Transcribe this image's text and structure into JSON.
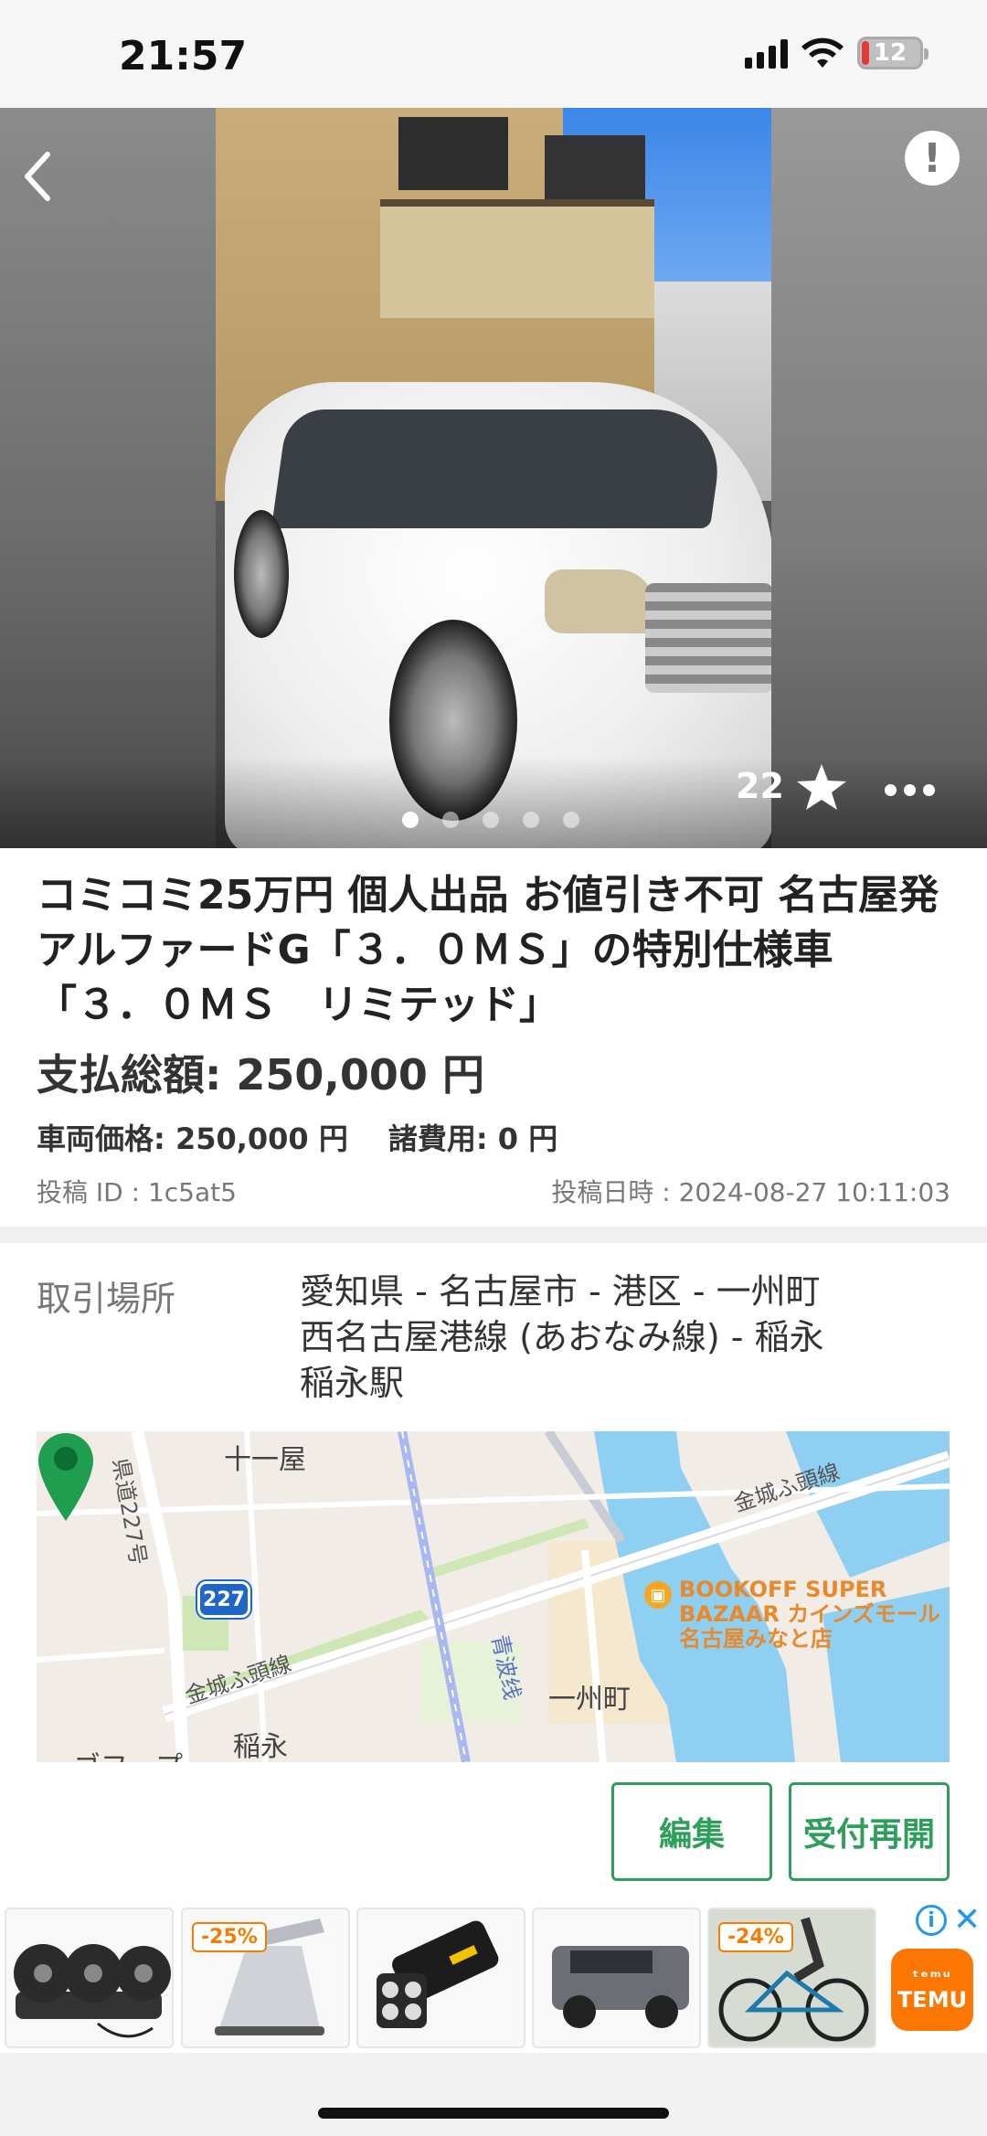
{
  "status_bar": {
    "time": "21:57",
    "battery": "12",
    "icons": [
      "signal-icon",
      "wifi-icon",
      "battery-icon"
    ]
  },
  "hero": {
    "favorites_count": "22",
    "photo_count": 5,
    "current_photo": 1,
    "icons": [
      "back-arrow-icon",
      "report-icon",
      "star-icon",
      "more-icon"
    ]
  },
  "listing": {
    "title": "コミコミ25万円 個人出品 お値引き不可 名古屋発 アルファードG「３．０ＭＳ」の特別仕様車「３．０ＭＳ　リミテッド」",
    "total_price": "支払総額: 250,000 円",
    "vehicle_price": "車両価格: 250,000 円",
    "fees": "諸費用: 0 円",
    "post_id": "投稿 ID : 1c5at5",
    "post_date": "投稿日時 : 2024-08-27 10:11:03"
  },
  "location": {
    "label": "取引場所",
    "line1": "愛知県 - 名古屋市 - 港区 - 一州町",
    "line2": "西名古屋港線 (あおなみ線) - 稲永",
    "line3": "稲永駅"
  },
  "map": {
    "labels": {
      "juichiya": "十一屋",
      "kinjo_top": "金城ふ頭線",
      "kinjo_bottom": "金城ふ頭線",
      "kendo": "県道227号",
      "route": "227",
      "isshu": "一州町",
      "aonami": "青波线",
      "inae": "稲永",
      "cut": "ゴフ・プ"
    },
    "poi": "BOOKOFF SUPER BAZAAR カインズモール名古屋みなと店"
  },
  "actions": {
    "edit": "編集",
    "resume": "受付再開"
  },
  "ad": {
    "badges": [
      "-25%",
      "-24%"
    ],
    "brand_top": "ᵗᵉᵐᵘ",
    "brand": "TEMU",
    "info": "i",
    "close": "✕",
    "items": [
      "car-fan-item",
      "laptop-stand-item",
      "flashlight-item",
      "toy-car-item",
      "bicycle-item"
    ]
  },
  "colors": {
    "accent_green": "#2e9e5b",
    "pin_green": "#1f9e4f",
    "temu_orange": "#fb7701",
    "poi_orange": "#e8892b",
    "route_blue": "#1e66c9"
  }
}
